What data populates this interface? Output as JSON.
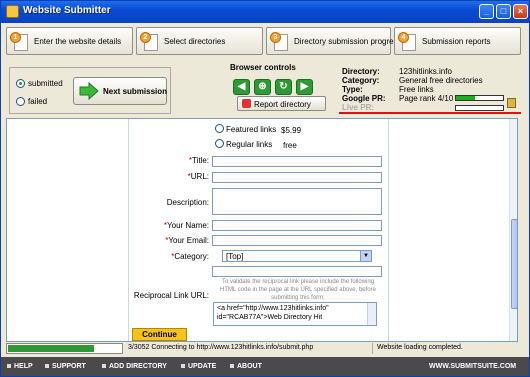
{
  "window": {
    "title": "Website Submitter"
  },
  "steps": [
    {
      "num": "1",
      "label": "Enter the website details"
    },
    {
      "num": "2",
      "label": "Select directories"
    },
    {
      "num": "3",
      "label": "Directory submission progress"
    },
    {
      "num": "4",
      "label": "Submission reports"
    }
  ],
  "submission_filter": {
    "submitted_label": "submitted",
    "failed_label": "failed",
    "selected": "submitted"
  },
  "next_button": "Next submission",
  "browser_controls": {
    "header": "Browser controls",
    "report_label": "Report directory"
  },
  "directory_info": {
    "directory_key": "Directory:",
    "directory_val": "123hitlinks.info",
    "category_key": "Category:",
    "category_val": "General free directories",
    "type_key": "Type:",
    "type_val": "Free links",
    "pr_key": "Google PR:",
    "pr_val": "Page rank 4/10",
    "pr_value": 0.4,
    "live_pr_key": "Live PR:"
  },
  "form": {
    "featured_label": "Featured links",
    "featured_price": "$5.99",
    "regular_label": "Regular links",
    "regular_price": "free",
    "title_label": "Title:",
    "url_label": "URL:",
    "description_label": "Description:",
    "your_name_label": "Your Name:",
    "your_email_label": "Your Email:",
    "category_label": "Category:",
    "category_value": "[Top]",
    "reciprocal_label": "Reciprocal Link URL:",
    "hint": "To validate the reciprocal link please include the following HTML code in the page at the URL specified above, before submitting this form:",
    "code_line1": "<a href=\"http://www.123hitlinks.info\"",
    "code_line2": "id=\"RCAB77A\">Web Directory Hit",
    "continue_label": "Continue"
  },
  "status": {
    "progress_value": 0.76,
    "message": "3/3052 Connecting to http://www.123hitlinks.info/submit.php",
    "load_message": "Website loading completed."
  },
  "footer": {
    "items": [
      "HELP",
      "SUPPORT",
      "ADD DIRECTORY",
      "UPDATE",
      "ABOUT"
    ],
    "brand": "WWW.SUBMITSUITE.COM"
  }
}
